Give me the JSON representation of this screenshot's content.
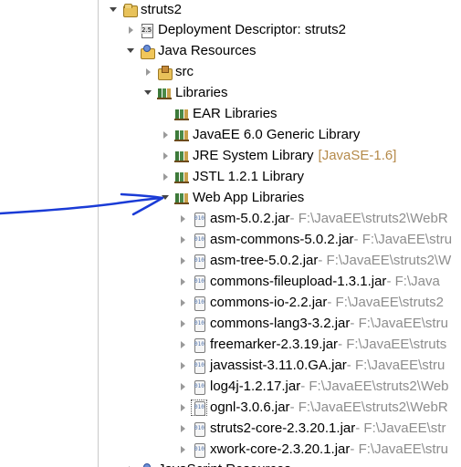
{
  "tree": {
    "project": {
      "label": "struts2"
    },
    "deployment_descriptor": {
      "label": "Deployment Descriptor: struts2"
    },
    "java_resources": {
      "label": "Java Resources"
    },
    "src": {
      "label": "src"
    },
    "libraries": {
      "label": "Libraries"
    },
    "ear_libraries": {
      "label": "EAR Libraries"
    },
    "javaee_library": {
      "label": "JavaEE 6.0 Generic Library"
    },
    "jre_library": {
      "label": "JRE System Library",
      "decoration": "[JavaSE-1.6]"
    },
    "jstl_library": {
      "label": "JSTL 1.2.1 Library"
    },
    "web_app_libraries": {
      "label": "Web App Libraries"
    },
    "jars": [
      {
        "name": "asm-5.0.2.jar",
        "path": " - F:\\JavaEE\\struts2\\WebR"
      },
      {
        "name": "asm-commons-5.0.2.jar",
        "path": " - F:\\JavaEE\\stru"
      },
      {
        "name": "asm-tree-5.0.2.jar",
        "path": " - F:\\JavaEE\\struts2\\W"
      },
      {
        "name": "commons-fileupload-1.3.1.jar",
        "path": " - F:\\Java"
      },
      {
        "name": "commons-io-2.2.jar",
        "path": " - F:\\JavaEE\\struts2"
      },
      {
        "name": "commons-lang3-3.2.jar",
        "path": " - F:\\JavaEE\\stru"
      },
      {
        "name": "freemarker-2.3.19.jar",
        "path": " - F:\\JavaEE\\struts"
      },
      {
        "name": "javassist-3.11.0.GA.jar",
        "path": " - F:\\JavaEE\\stru"
      },
      {
        "name": "log4j-1.2.17.jar",
        "path": " - F:\\JavaEE\\struts2\\Web"
      },
      {
        "name": "ognl-3.0.6.jar",
        "path": " - F:\\JavaEE\\struts2\\WebR"
      },
      {
        "name": "struts2-core-2.3.20.1.jar",
        "path": " - F:\\JavaEE\\str"
      },
      {
        "name": "xwork-core-2.3.20.1.jar",
        "path": " - F:\\JavaEE\\stru"
      }
    ],
    "partial_bottom": {
      "label": "JavaScript Resources"
    }
  }
}
